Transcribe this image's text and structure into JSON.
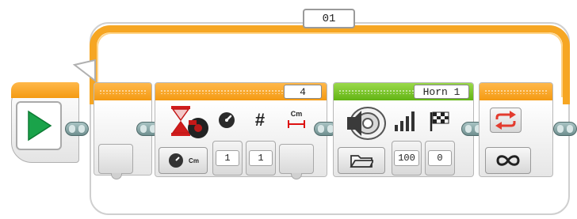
{
  "loop": {
    "name": "01",
    "count_mode_icon": "infinity-icon"
  },
  "start": {
    "icon": "play-icon"
  },
  "move_block": {
    "header_value": "4",
    "mode_icon": "rotation-cm-icon",
    "mode_label": "Cm",
    "params": [
      {
        "icon": "speed-gauge-icon",
        "value": "1"
      },
      {
        "icon": "hash-icon",
        "label": "#",
        "value": "1"
      },
      {
        "icon": "distance-cm-icon",
        "label": "Cm"
      }
    ]
  },
  "sound_block": {
    "file_name": "Horn 1",
    "mode_icon": "folder-icon",
    "params": [
      {
        "icon": "volume-bars-icon",
        "value": "100"
      },
      {
        "icon": "checkered-flag-icon",
        "value": "0"
      }
    ]
  },
  "colors": {
    "orange": "#f49a12",
    "green": "#62b414",
    "play_green": "#1aa34a",
    "loop_arrow_red": "#e33b2e"
  }
}
